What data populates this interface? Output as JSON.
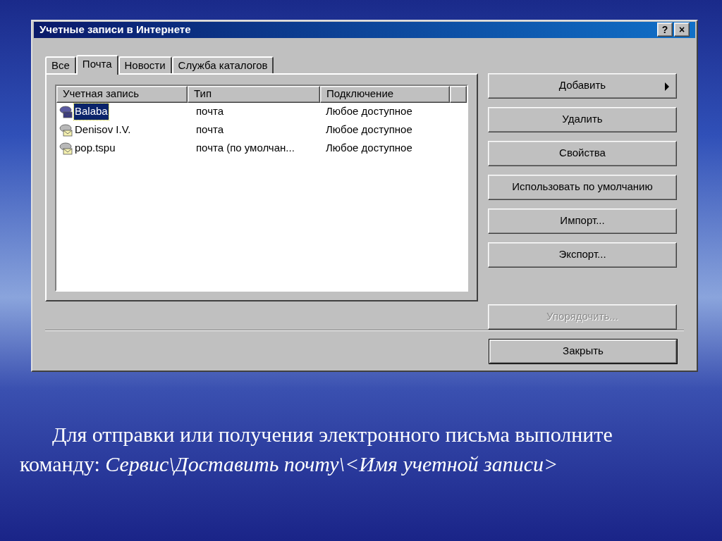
{
  "window": {
    "title": "Учетные записи в Интернете",
    "title_buttons": [
      "?",
      "×"
    ]
  },
  "tabs": [
    {
      "label": "Все",
      "selected": false
    },
    {
      "label": "Почта",
      "selected": true
    },
    {
      "label": "Новости",
      "selected": false
    },
    {
      "label": "Служба каталогов",
      "selected": false
    }
  ],
  "table": {
    "columns": [
      "Учетная запись",
      "Тип",
      "Подключение"
    ],
    "rows": [
      {
        "cells": [
          "Balaba",
          "почта",
          "Любое доступное"
        ],
        "selected": true
      },
      {
        "cells": [
          "Denisov I.V.",
          "почта",
          "Любое доступное"
        ],
        "selected": false
      },
      {
        "cells": [
          "pop.tspu",
          "почта (по умолчан...",
          "Любое доступное"
        ],
        "selected": false
      }
    ]
  },
  "buttons": [
    {
      "label": "Добавить",
      "submenu": true,
      "disabled": false
    },
    {
      "label": "Удалить",
      "submenu": false,
      "disabled": false
    },
    {
      "label": "Свойства",
      "submenu": false,
      "disabled": false
    },
    {
      "label": "Использовать по умолчанию",
      "submenu": false,
      "disabled": false
    },
    {
      "label": "Импорт...",
      "submenu": false,
      "disabled": false
    },
    {
      "label": "Экспорт...",
      "submenu": false,
      "disabled": false
    },
    {
      "label": "Упорядочить...",
      "submenu": false,
      "disabled": true
    }
  ],
  "close_button": "Закрыть",
  "caption": "Для отправки или получения электронного письма выполните команду: *Сервис\\Доставить почту\\<Имя учетной записи>*"
}
